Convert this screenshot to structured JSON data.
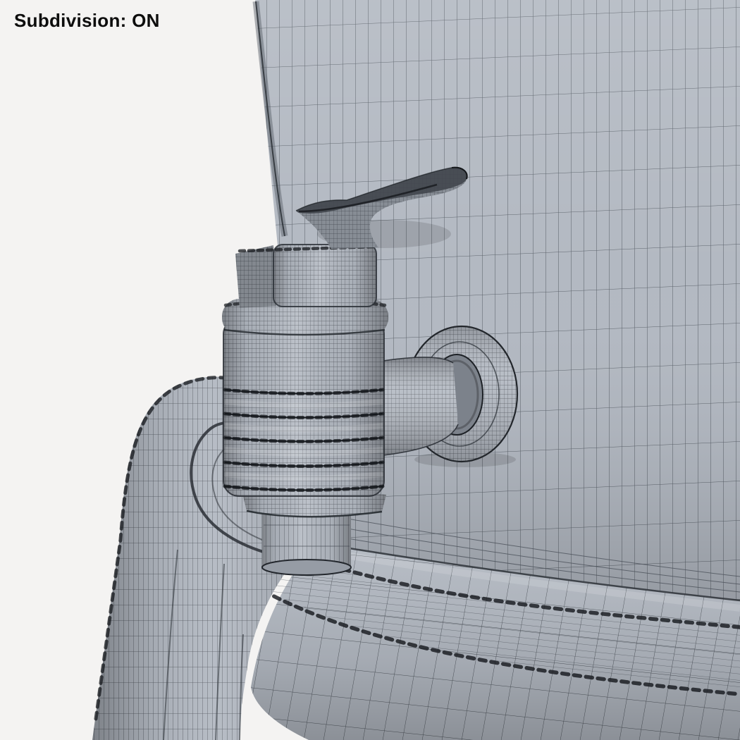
{
  "overlay": {
    "subdivision_label": "Subdivision: ON"
  },
  "colors": {
    "background": "#f4f3f2",
    "surface": "#b3b9c2",
    "surface_dark": "#9ca2ab",
    "hole_shadow": "#7c828b",
    "wire": "#4d535c",
    "wire_dense": "#33383f",
    "seam": "#14171b",
    "label_text": "#0d0d0d"
  }
}
